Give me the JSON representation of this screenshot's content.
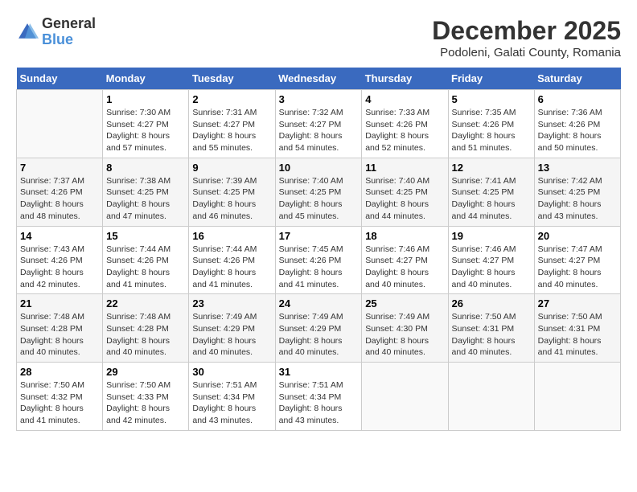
{
  "logo": {
    "text_general": "General",
    "text_blue": "Blue",
    "icon_title": "GeneralBlue logo"
  },
  "title": "December 2025",
  "location": "Podoleni, Galati County, Romania",
  "weekdays": [
    "Sunday",
    "Monday",
    "Tuesday",
    "Wednesday",
    "Thursday",
    "Friday",
    "Saturday"
  ],
  "weeks": [
    [
      {
        "day": "",
        "info": ""
      },
      {
        "day": "1",
        "info": "Sunrise: 7:30 AM\nSunset: 4:27 PM\nDaylight: 8 hours\nand 57 minutes."
      },
      {
        "day": "2",
        "info": "Sunrise: 7:31 AM\nSunset: 4:27 PM\nDaylight: 8 hours\nand 55 minutes."
      },
      {
        "day": "3",
        "info": "Sunrise: 7:32 AM\nSunset: 4:27 PM\nDaylight: 8 hours\nand 54 minutes."
      },
      {
        "day": "4",
        "info": "Sunrise: 7:33 AM\nSunset: 4:26 PM\nDaylight: 8 hours\nand 52 minutes."
      },
      {
        "day": "5",
        "info": "Sunrise: 7:35 AM\nSunset: 4:26 PM\nDaylight: 8 hours\nand 51 minutes."
      },
      {
        "day": "6",
        "info": "Sunrise: 7:36 AM\nSunset: 4:26 PM\nDaylight: 8 hours\nand 50 minutes."
      }
    ],
    [
      {
        "day": "7",
        "info": "Sunrise: 7:37 AM\nSunset: 4:26 PM\nDaylight: 8 hours\nand 48 minutes."
      },
      {
        "day": "8",
        "info": "Sunrise: 7:38 AM\nSunset: 4:25 PM\nDaylight: 8 hours\nand 47 minutes."
      },
      {
        "day": "9",
        "info": "Sunrise: 7:39 AM\nSunset: 4:25 PM\nDaylight: 8 hours\nand 46 minutes."
      },
      {
        "day": "10",
        "info": "Sunrise: 7:40 AM\nSunset: 4:25 PM\nDaylight: 8 hours\nand 45 minutes."
      },
      {
        "day": "11",
        "info": "Sunrise: 7:40 AM\nSunset: 4:25 PM\nDaylight: 8 hours\nand 44 minutes."
      },
      {
        "day": "12",
        "info": "Sunrise: 7:41 AM\nSunset: 4:25 PM\nDaylight: 8 hours\nand 44 minutes."
      },
      {
        "day": "13",
        "info": "Sunrise: 7:42 AM\nSunset: 4:25 PM\nDaylight: 8 hours\nand 43 minutes."
      }
    ],
    [
      {
        "day": "14",
        "info": "Sunrise: 7:43 AM\nSunset: 4:26 PM\nDaylight: 8 hours\nand 42 minutes."
      },
      {
        "day": "15",
        "info": "Sunrise: 7:44 AM\nSunset: 4:26 PM\nDaylight: 8 hours\nand 41 minutes."
      },
      {
        "day": "16",
        "info": "Sunrise: 7:44 AM\nSunset: 4:26 PM\nDaylight: 8 hours\nand 41 minutes."
      },
      {
        "day": "17",
        "info": "Sunrise: 7:45 AM\nSunset: 4:26 PM\nDaylight: 8 hours\nand 41 minutes."
      },
      {
        "day": "18",
        "info": "Sunrise: 7:46 AM\nSunset: 4:27 PM\nDaylight: 8 hours\nand 40 minutes."
      },
      {
        "day": "19",
        "info": "Sunrise: 7:46 AM\nSunset: 4:27 PM\nDaylight: 8 hours\nand 40 minutes."
      },
      {
        "day": "20",
        "info": "Sunrise: 7:47 AM\nSunset: 4:27 PM\nDaylight: 8 hours\nand 40 minutes."
      }
    ],
    [
      {
        "day": "21",
        "info": "Sunrise: 7:48 AM\nSunset: 4:28 PM\nDaylight: 8 hours\nand 40 minutes."
      },
      {
        "day": "22",
        "info": "Sunrise: 7:48 AM\nSunset: 4:28 PM\nDaylight: 8 hours\nand 40 minutes."
      },
      {
        "day": "23",
        "info": "Sunrise: 7:49 AM\nSunset: 4:29 PM\nDaylight: 8 hours\nand 40 minutes."
      },
      {
        "day": "24",
        "info": "Sunrise: 7:49 AM\nSunset: 4:29 PM\nDaylight: 8 hours\nand 40 minutes."
      },
      {
        "day": "25",
        "info": "Sunrise: 7:49 AM\nSunset: 4:30 PM\nDaylight: 8 hours\nand 40 minutes."
      },
      {
        "day": "26",
        "info": "Sunrise: 7:50 AM\nSunset: 4:31 PM\nDaylight: 8 hours\nand 40 minutes."
      },
      {
        "day": "27",
        "info": "Sunrise: 7:50 AM\nSunset: 4:31 PM\nDaylight: 8 hours\nand 41 minutes."
      }
    ],
    [
      {
        "day": "28",
        "info": "Sunrise: 7:50 AM\nSunset: 4:32 PM\nDaylight: 8 hours\nand 41 minutes."
      },
      {
        "day": "29",
        "info": "Sunrise: 7:50 AM\nSunset: 4:33 PM\nDaylight: 8 hours\nand 42 minutes."
      },
      {
        "day": "30",
        "info": "Sunrise: 7:51 AM\nSunset: 4:34 PM\nDaylight: 8 hours\nand 43 minutes."
      },
      {
        "day": "31",
        "info": "Sunrise: 7:51 AM\nSunset: 4:34 PM\nDaylight: 8 hours\nand 43 minutes."
      },
      {
        "day": "",
        "info": ""
      },
      {
        "day": "",
        "info": ""
      },
      {
        "day": "",
        "info": ""
      }
    ]
  ]
}
